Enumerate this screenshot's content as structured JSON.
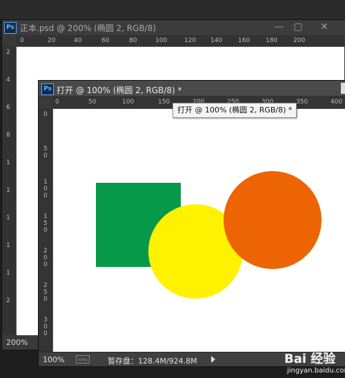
{
  "back_window": {
    "title": "正本.psd @ 200% (椭圆 2, RGB/8)",
    "zoom": "200%",
    "controls": {
      "min": "—",
      "max": "▢",
      "close": "✕"
    },
    "ruler_top": [
      "0",
      "20",
      "40",
      "60",
      "80",
      "100",
      "120",
      "140",
      "160",
      "180",
      "200"
    ],
    "ruler_left": [
      "2",
      "4",
      "6",
      "8",
      "1",
      "1",
      "1",
      "1",
      "1",
      "2"
    ]
  },
  "front_window": {
    "title": "打开 @ 100% (椭圆 2, RGB/8) *",
    "ruler_top": [
      "0",
      "50",
      "100",
      "150",
      "200",
      "250",
      "300",
      "350",
      "400"
    ],
    "ruler_left": [
      "0",
      "5\n0",
      "1\n0\n0",
      "1\n5\n0",
      "2\n0\n0",
      "2\n5\n0",
      "3\n0\n0"
    ],
    "status": {
      "zoom": "100%",
      "scratch": "暂存盘：128.4M/924.8M"
    },
    "shapes": [
      {
        "name": "green-square",
        "color": "#06994a"
      },
      {
        "name": "yellow-circle",
        "color": "#fff200"
      },
      {
        "name": "orange-circle",
        "color": "#ec6502"
      }
    ]
  },
  "tooltip": "打开 @ 100% (椭圆 2, RGB/8) *",
  "icons": {
    "ps": "Ps"
  },
  "watermark": {
    "brand": "Bai 经验",
    "site": "jingyan.baidu.com"
  }
}
